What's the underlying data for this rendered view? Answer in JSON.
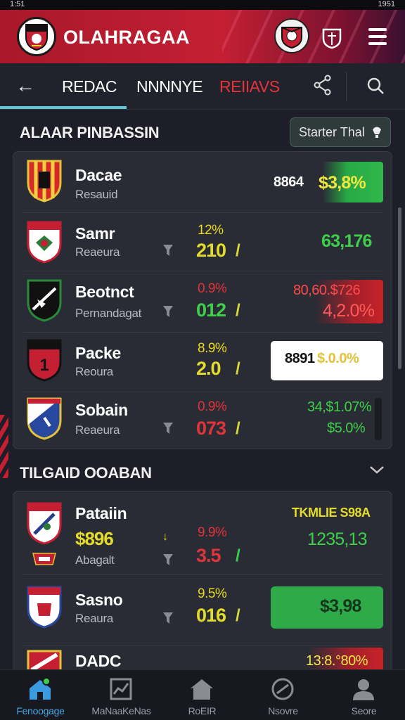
{
  "status": {
    "time": "1:51",
    "battery": "1951"
  },
  "header": {
    "title": "OLAHRAGAA"
  },
  "tabs": {
    "items": [
      "REDAC",
      "NNNNYE",
      "REIIAVS"
    ]
  },
  "section1": {
    "title": "ALAAR PINBASSIN",
    "filter_label": "Starter Thal"
  },
  "section2": {
    "title": "TILGAID OOABAN"
  },
  "list1": [
    {
      "name": "Dacae",
      "sub": "Resauid",
      "price": "8864",
      "change": "$3,8%"
    },
    {
      "name": "Samr",
      "sub": "Reaeura",
      "pct": "12%",
      "big": "210",
      "value": "63,176"
    },
    {
      "name": "Beotnct",
      "sub": "Pernandagat",
      "pct": "0.9%",
      "big": "012",
      "value": "80,60.$726",
      "value2": "4,2.0%"
    },
    {
      "name": "Packe",
      "sub": "Reoura",
      "pct": "8.9%",
      "big": "2.0",
      "price": "8891",
      "value": "$.0.0%"
    },
    {
      "name": "Sobain",
      "sub": "Reaeura",
      "pct": "0.9%",
      "big": "073",
      "value": "34,$1.07%",
      "value2": "$5.0%"
    }
  ],
  "list2": [
    {
      "name": "Pataiin",
      "sub": "Abagalt",
      "price": "$896",
      "pct": "9.9%",
      "big": "3.5",
      "value_top": "TKMLIE S98A",
      "value": "1235,13"
    },
    {
      "name": "Sasno",
      "sub": "Reaura",
      "pct": "9.5%",
      "big": "016",
      "value": "$3,98"
    },
    {
      "name": "DADC",
      "value": "13:8.°80%"
    }
  ],
  "nav": [
    "Fenoogage",
    "MaNaaKeNas",
    "RoEIR",
    "Nsovre",
    "Seore"
  ],
  "colors": {
    "brand": "#c41f33",
    "accent": "#5fc7d8",
    "green": "#3ecf4a",
    "red": "#e0343a",
    "yellow": "#e3dc2a"
  },
  "icons": [
    "back-arrow-icon",
    "share-icon",
    "search-icon",
    "menu-icon",
    "bulb-icon",
    "filter-icon",
    "chevron-down-icon",
    "home-icon",
    "chart-icon",
    "house-icon",
    "ball-icon",
    "profile-icon"
  ]
}
